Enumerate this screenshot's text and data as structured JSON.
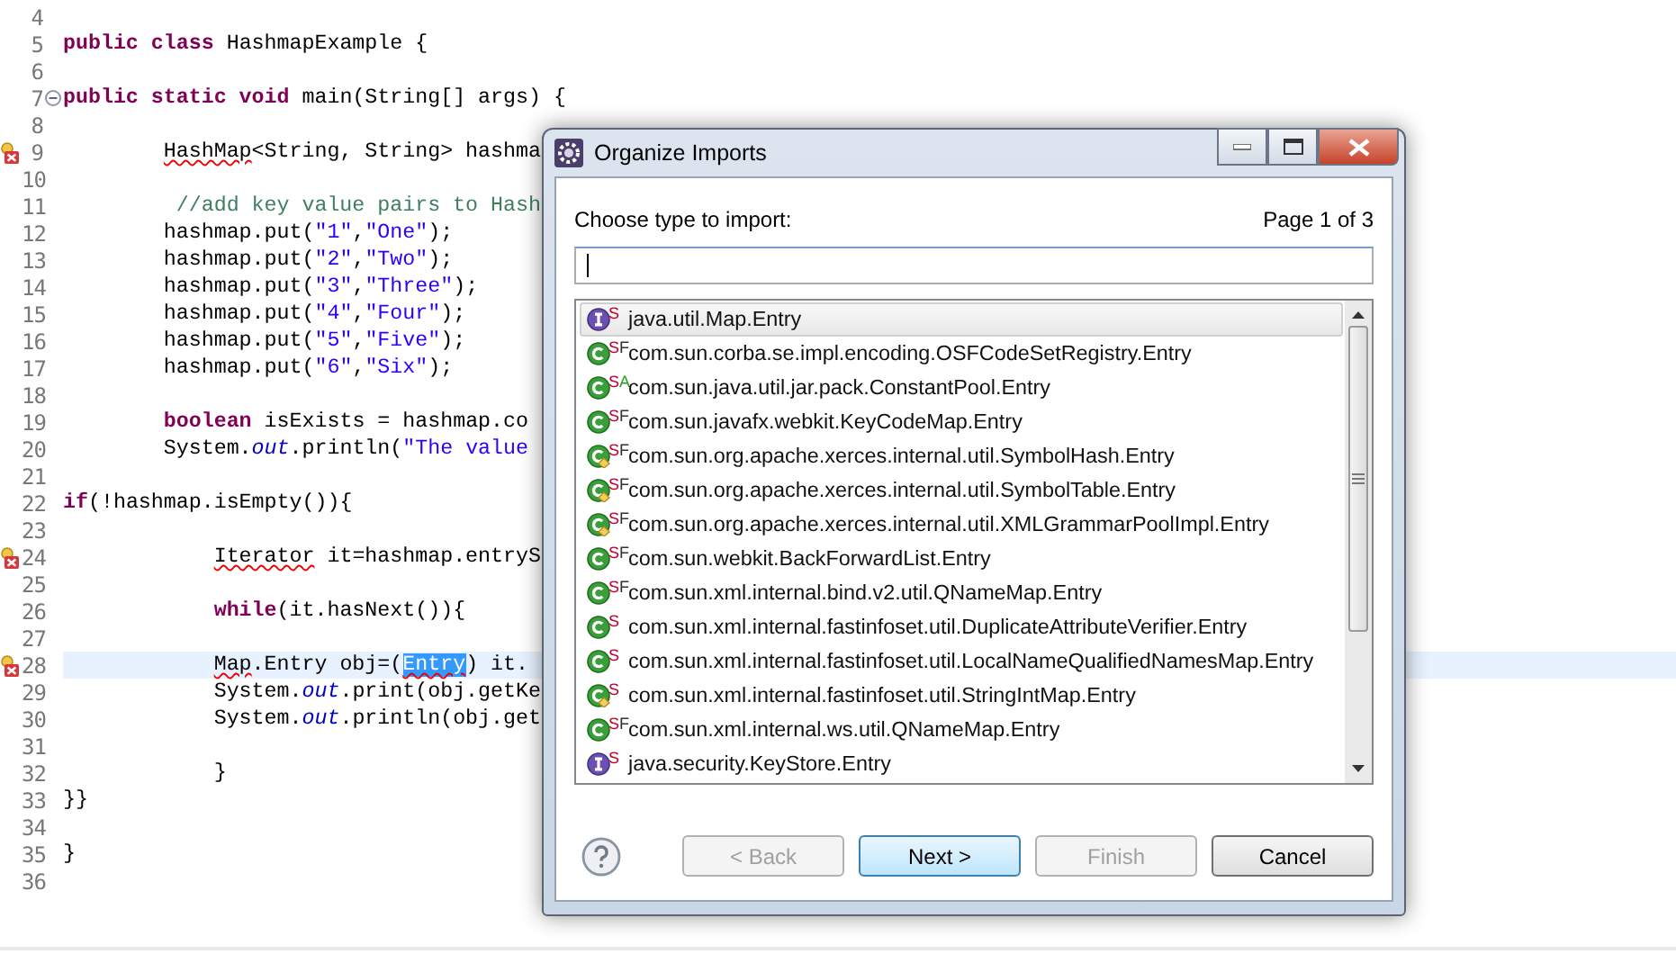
{
  "editor": {
    "lines": [
      {
        "number": "4",
        "error": false,
        "fold": false,
        "current": false
      },
      {
        "number": "5",
        "error": false,
        "fold": false,
        "current": false,
        "tokens": [
          {
            "text": "public class",
            "kind": "keyword"
          },
          {
            "text": " HashmapExample {",
            "kind": "plain"
          }
        ]
      },
      {
        "number": "6",
        "error": false,
        "fold": false,
        "current": false
      },
      {
        "number": "7",
        "error": false,
        "fold": true,
        "current": false,
        "tokens": [
          {
            "text": "public static void",
            "kind": "keyword"
          },
          {
            "text": " main(String[] args) {",
            "kind": "plain"
          }
        ]
      },
      {
        "number": "8",
        "error": false,
        "fold": false,
        "current": false
      },
      {
        "number": "9",
        "error": true,
        "fold": false,
        "current": false,
        "tokens": [
          {
            "text": "        HashMap",
            "kind": "error"
          },
          {
            "text": "<String, String> hashma",
            "kind": "plain"
          }
        ]
      },
      {
        "number": "10",
        "error": false,
        "fold": false,
        "current": false
      },
      {
        "number": "11",
        "error": false,
        "fold": false,
        "current": false,
        "tokens": [
          {
            "text": "         //add key value pairs to Hash",
            "kind": "comment"
          }
        ]
      },
      {
        "number": "12",
        "error": false,
        "fold": false,
        "current": false,
        "tokens": [
          {
            "text": "        hashmap.put(",
            "kind": "plain"
          },
          {
            "text": "\"1\"",
            "kind": "string"
          },
          {
            "text": ",",
            "kind": "plain"
          },
          {
            "text": "\"One\"",
            "kind": "string"
          },
          {
            "text": ");",
            "kind": "plain"
          }
        ]
      },
      {
        "number": "13",
        "error": false,
        "fold": false,
        "current": false,
        "tokens": [
          {
            "text": "        hashmap.put(",
            "kind": "plain"
          },
          {
            "text": "\"2\"",
            "kind": "string"
          },
          {
            "text": ",",
            "kind": "plain"
          },
          {
            "text": "\"Two\"",
            "kind": "string"
          },
          {
            "text": ");",
            "kind": "plain"
          }
        ]
      },
      {
        "number": "14",
        "error": false,
        "fold": false,
        "current": false,
        "tokens": [
          {
            "text": "        hashmap.put(",
            "kind": "plain"
          },
          {
            "text": "\"3\"",
            "kind": "string"
          },
          {
            "text": ",",
            "kind": "plain"
          },
          {
            "text": "\"Three\"",
            "kind": "string"
          },
          {
            "text": ");",
            "kind": "plain"
          }
        ]
      },
      {
        "number": "15",
        "error": false,
        "fold": false,
        "current": false,
        "tokens": [
          {
            "text": "        hashmap.put(",
            "kind": "plain"
          },
          {
            "text": "\"4\"",
            "kind": "string"
          },
          {
            "text": ",",
            "kind": "plain"
          },
          {
            "text": "\"Four\"",
            "kind": "string"
          },
          {
            "text": ");",
            "kind": "plain"
          }
        ]
      },
      {
        "number": "16",
        "error": false,
        "fold": false,
        "current": false,
        "tokens": [
          {
            "text": "        hashmap.put(",
            "kind": "plain"
          },
          {
            "text": "\"5\"",
            "kind": "string"
          },
          {
            "text": ",",
            "kind": "plain"
          },
          {
            "text": "\"Five\"",
            "kind": "string"
          },
          {
            "text": ");",
            "kind": "plain"
          }
        ]
      },
      {
        "number": "17",
        "error": false,
        "fold": false,
        "current": false,
        "tokens": [
          {
            "text": "        hashmap.put(",
            "kind": "plain"
          },
          {
            "text": "\"6\"",
            "kind": "string"
          },
          {
            "text": ",",
            "kind": "plain"
          },
          {
            "text": "\"Six\"",
            "kind": "string"
          },
          {
            "text": ");",
            "kind": "plain"
          }
        ]
      },
      {
        "number": "18",
        "error": false,
        "fold": false,
        "current": false
      },
      {
        "number": "19",
        "error": false,
        "fold": false,
        "current": false,
        "tokens": [
          {
            "text": "        boolean",
            "kind": "keyword"
          },
          {
            "text": " isExists = hashmap.co",
            "kind": "plain"
          }
        ]
      },
      {
        "number": "20",
        "error": false,
        "fold": false,
        "current": false,
        "tokens": [
          {
            "text": "        System.",
            "kind": "plain"
          },
          {
            "text": "out",
            "kind": "field"
          },
          {
            "text": ".println(",
            "kind": "plain"
          },
          {
            "text": "\"The value",
            "kind": "string"
          }
        ]
      },
      {
        "number": "21",
        "error": false,
        "fold": false,
        "current": false
      },
      {
        "number": "22",
        "error": false,
        "fold": false,
        "current": false,
        "tokens": [
          {
            "text": "if",
            "kind": "keyword"
          },
          {
            "text": "(!hashmap.isEmpty()){",
            "kind": "plain"
          }
        ]
      },
      {
        "number": "23",
        "error": false,
        "fold": false,
        "current": false
      },
      {
        "number": "24",
        "error": true,
        "fold": false,
        "current": false,
        "tokens": [
          {
            "text": "            Iterator",
            "kind": "error"
          },
          {
            "text": " it=hashmap.entryS",
            "kind": "plain"
          }
        ]
      },
      {
        "number": "25",
        "error": false,
        "fold": false,
        "current": false
      },
      {
        "number": "26",
        "error": false,
        "fold": false,
        "current": false,
        "tokens": [
          {
            "text": "            while",
            "kind": "keyword"
          },
          {
            "text": "(it.hasNext()){",
            "kind": "plain"
          }
        ]
      },
      {
        "number": "27",
        "error": false,
        "fold": false,
        "current": false
      },
      {
        "number": "28",
        "error": true,
        "fold": false,
        "current": true,
        "tokens": [
          {
            "text": "            Map",
            "kind": "error"
          },
          {
            "text": ".Entry obj=(",
            "kind": "plain"
          },
          {
            "text": "Entry",
            "kind": "error_selected"
          },
          {
            "text": ") it.",
            "kind": "plain"
          }
        ]
      },
      {
        "number": "29",
        "error": false,
        "fold": false,
        "current": false,
        "tokens": [
          {
            "text": "            System.",
            "kind": "plain"
          },
          {
            "text": "out",
            "kind": "field"
          },
          {
            "text": ".print(obj.getKe",
            "kind": "plain"
          }
        ]
      },
      {
        "number": "30",
        "error": false,
        "fold": false,
        "current": false,
        "tokens": [
          {
            "text": "            System.",
            "kind": "plain"
          },
          {
            "text": "out",
            "kind": "field"
          },
          {
            "text": ".println(obj.get",
            "kind": "plain"
          }
        ]
      },
      {
        "number": "31",
        "error": false,
        "fold": false,
        "current": false
      },
      {
        "number": "32",
        "error": false,
        "fold": false,
        "current": false,
        "tokens": [
          {
            "text": "            }",
            "kind": "plain"
          }
        ]
      },
      {
        "number": "33",
        "error": false,
        "fold": false,
        "current": false,
        "tokens": [
          {
            "text": "}}",
            "kind": "plain"
          }
        ]
      },
      {
        "number": "34",
        "error": false,
        "fold": false,
        "current": false
      },
      {
        "number": "35",
        "error": false,
        "fold": false,
        "current": false,
        "tokens": [
          {
            "text": "}",
            "kind": "plain"
          }
        ]
      },
      {
        "number": "36",
        "error": false,
        "fold": false,
        "current": false
      }
    ]
  },
  "dialog": {
    "title": "Organize Imports",
    "prompt": "Choose type to import:",
    "page": "Page 1 of 3",
    "items": [
      {
        "text": "java.util.Map.Entry",
        "kind": "interface",
        "overlay": false,
        "selected": true,
        "badges": [
          {
            "text": "S",
            "kind": "static"
          }
        ]
      },
      {
        "text": "com.sun.corba.se.impl.encoding.OSFCodeSetRegistry.Entry",
        "kind": "class",
        "overlay": false,
        "selected": false,
        "badges": [
          {
            "text": "S",
            "kind": "static"
          },
          {
            "text": "F",
            "kind": "final"
          }
        ]
      },
      {
        "text": "com.sun.java.util.jar.pack.ConstantPool.Entry",
        "kind": "class",
        "overlay": false,
        "selected": false,
        "badges": [
          {
            "text": "S",
            "kind": "static"
          },
          {
            "text": "A",
            "kind": "abstract"
          }
        ]
      },
      {
        "text": "com.sun.javafx.webkit.KeyCodeMap.Entry",
        "kind": "class",
        "overlay": false,
        "selected": false,
        "badges": [
          {
            "text": "S",
            "kind": "static"
          },
          {
            "text": "F",
            "kind": "final"
          }
        ]
      },
      {
        "text": "com.sun.org.apache.xerces.internal.util.SymbolHash.Entry",
        "kind": "class",
        "overlay": true,
        "selected": false,
        "badges": [
          {
            "text": "S",
            "kind": "static"
          },
          {
            "text": "F",
            "kind": "final"
          }
        ]
      },
      {
        "text": "com.sun.org.apache.xerces.internal.util.SymbolTable.Entry",
        "kind": "class",
        "overlay": true,
        "selected": false,
        "badges": [
          {
            "text": "S",
            "kind": "static"
          },
          {
            "text": "F",
            "kind": "final"
          }
        ]
      },
      {
        "text": "com.sun.org.apache.xerces.internal.util.XMLGrammarPoolImpl.Entry",
        "kind": "class",
        "overlay": true,
        "selected": false,
        "badges": [
          {
            "text": "S",
            "kind": "static"
          },
          {
            "text": "F",
            "kind": "final"
          }
        ]
      },
      {
        "text": "com.sun.webkit.BackForwardList.Entry",
        "kind": "class",
        "overlay": false,
        "selected": false,
        "badges": [
          {
            "text": "S",
            "kind": "static"
          },
          {
            "text": "F",
            "kind": "final"
          }
        ]
      },
      {
        "text": "com.sun.xml.internal.bind.v2.util.QNameMap.Entry",
        "kind": "class",
        "overlay": false,
        "selected": false,
        "badges": [
          {
            "text": "S",
            "kind": "static"
          },
          {
            "text": "F",
            "kind": "final"
          }
        ]
      },
      {
        "text": "com.sun.xml.internal.fastinfoset.util.DuplicateAttributeVerifier.Entry",
        "kind": "class",
        "overlay": false,
        "selected": false,
        "badges": [
          {
            "text": "S",
            "kind": "static"
          }
        ]
      },
      {
        "text": "com.sun.xml.internal.fastinfoset.util.LocalNameQualifiedNamesMap.Entry",
        "kind": "class",
        "overlay": false,
        "selected": false,
        "badges": [
          {
            "text": "S",
            "kind": "static"
          }
        ]
      },
      {
        "text": "com.sun.xml.internal.fastinfoset.util.StringIntMap.Entry",
        "kind": "class",
        "overlay": true,
        "selected": false,
        "badges": [
          {
            "text": "S",
            "kind": "static"
          }
        ]
      },
      {
        "text": "com.sun.xml.internal.ws.util.QNameMap.Entry",
        "kind": "class",
        "overlay": false,
        "selected": false,
        "badges": [
          {
            "text": "S",
            "kind": "static"
          },
          {
            "text": "F",
            "kind": "final"
          }
        ]
      },
      {
        "text": "java.security.KeyStore.Entry",
        "kind": "interface",
        "overlay": false,
        "selected": false,
        "badges": [
          {
            "text": "S",
            "kind": "static"
          }
        ]
      }
    ],
    "buttons": [
      {
        "label": "< Back",
        "disabled": true,
        "default": false
      },
      {
        "label": "Next >",
        "disabled": false,
        "default": true
      },
      {
        "label": "Finish",
        "disabled": true,
        "default": false
      },
      {
        "label": "Cancel",
        "disabled": false,
        "default": false
      }
    ]
  }
}
